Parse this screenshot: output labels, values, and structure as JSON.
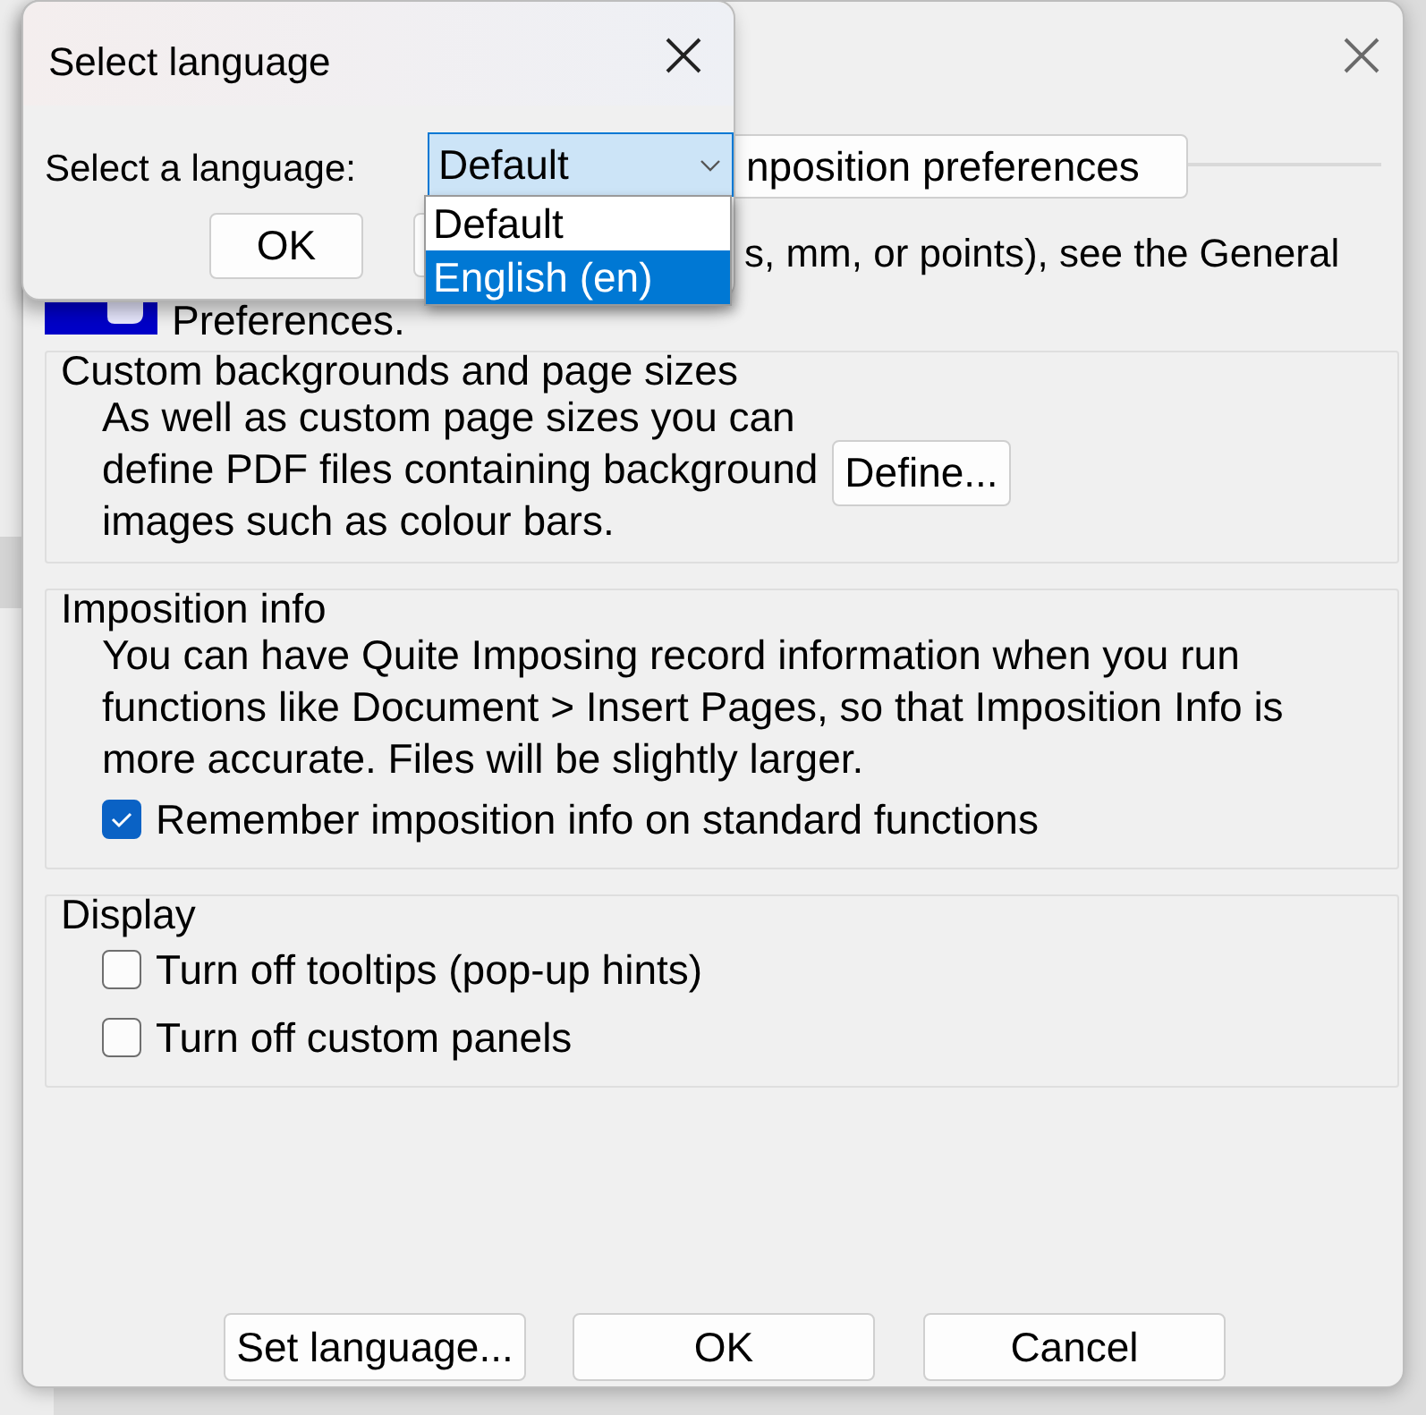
{
  "language_dialog": {
    "title": "Select language",
    "label": "Select a language:",
    "select": {
      "value": "Default"
    },
    "options": [
      {
        "label": "Default",
        "selected": false
      },
      {
        "label": "English (en)",
        "selected": true
      }
    ],
    "buttons": [
      "OK"
    ]
  },
  "preferences_dialog": {
    "imposition_button": "nposition preferences",
    "units_text": "s, mm, or points), see the General",
    "preferences_text": "Preferences.",
    "groups": [
      {
        "title": "Custom backgrounds and page sizes",
        "text": "As well as custom page sizes you can define PDF files containing background images such as colour bars.",
        "button": "Define..."
      },
      {
        "title": "Imposition info",
        "text": "You can have Quite Imposing record information when you run functions like Document > Insert Pages, so that Imposition Info is more accurate. Files will be slightly larger.",
        "checkboxes": [
          {
            "label": "Remember imposition info on standard functions",
            "checked": true
          }
        ]
      },
      {
        "title": "Display",
        "checkboxes": [
          {
            "label": "Turn off tooltips (pop-up hints)",
            "checked": false
          },
          {
            "label": "Turn off custom panels",
            "checked": false
          }
        ]
      }
    ],
    "buttons": [
      "Set language...",
      "OK",
      "Cancel"
    ]
  }
}
